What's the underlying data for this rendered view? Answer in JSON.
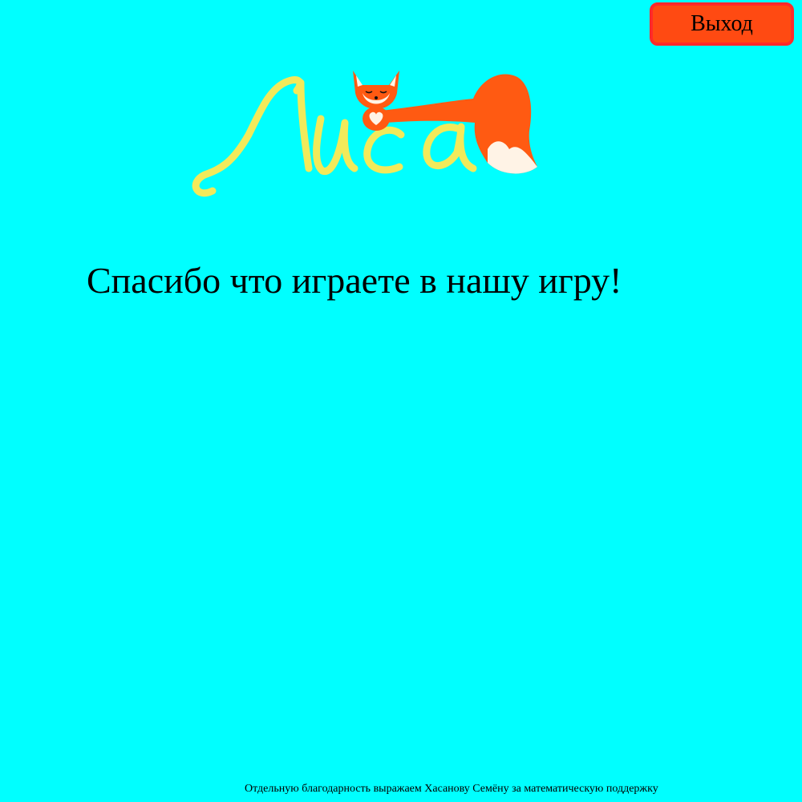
{
  "header": {
    "exit_label": "Выход"
  },
  "logo": {
    "wordmark": "Лиса",
    "mascot": "fox-icon",
    "text_color": "#f2ea5a",
    "fox_color": "#ff5a12"
  },
  "main": {
    "thanks_text": "Спасибо что играете в нашу игру!"
  },
  "footer": {
    "credits_text": "Отдельную благодарность выражаем Хасанову Семёну за математическую поддержку"
  },
  "colors": {
    "background": "#00ffff",
    "button_fill": "#ff4a12",
    "button_border": "#ff2a2a"
  }
}
